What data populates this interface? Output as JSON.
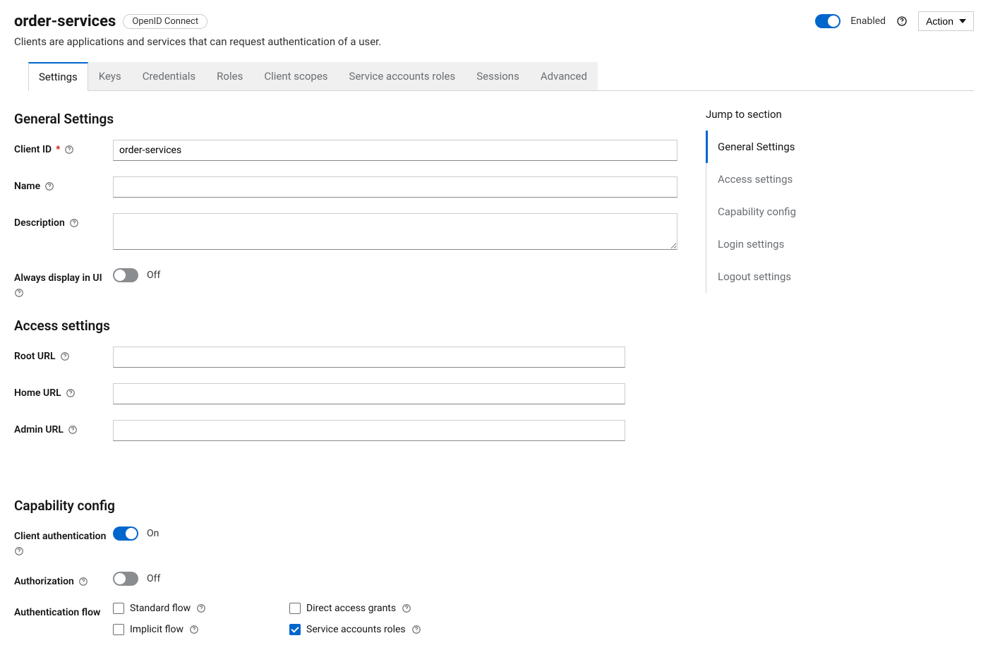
{
  "header": {
    "title": "order-services",
    "badge": "OpenID Connect",
    "subtitle": "Clients are applications and services that can request authentication of a user.",
    "enabled_label": "Enabled",
    "action_label": "Action"
  },
  "tabs": [
    {
      "label": "Settings",
      "active": true
    },
    {
      "label": "Keys"
    },
    {
      "label": "Credentials"
    },
    {
      "label": "Roles"
    },
    {
      "label": "Client scopes"
    },
    {
      "label": "Service accounts roles"
    },
    {
      "label": "Sessions"
    },
    {
      "label": "Advanced"
    }
  ],
  "sections": {
    "general": {
      "title": "General Settings",
      "client_id": {
        "label": "Client ID",
        "value": "order-services"
      },
      "name": {
        "label": "Name",
        "value": ""
      },
      "description": {
        "label": "Description",
        "value": ""
      },
      "always_display": {
        "label": "Always display in UI",
        "state": "Off"
      }
    },
    "access": {
      "title": "Access settings",
      "root_url": {
        "label": "Root URL",
        "value": ""
      },
      "home_url": {
        "label": "Home URL",
        "value": ""
      },
      "admin_url": {
        "label": "Admin URL",
        "value": ""
      }
    },
    "capability": {
      "title": "Capability config",
      "client_auth": {
        "label": "Client authentication",
        "state": "On"
      },
      "authorization": {
        "label": "Authorization",
        "state": "Off"
      },
      "auth_flow_label": "Authentication flow",
      "flows": {
        "standard": {
          "label": "Standard flow",
          "checked": false
        },
        "direct": {
          "label": "Direct access grants",
          "checked": false
        },
        "implicit": {
          "label": "Implicit flow",
          "checked": false
        },
        "service": {
          "label": "Service accounts roles",
          "checked": true
        }
      }
    }
  },
  "jump": {
    "title": "Jump to section",
    "items": [
      {
        "label": "General Settings",
        "active": true
      },
      {
        "label": "Access settings"
      },
      {
        "label": "Capability config"
      },
      {
        "label": "Login settings"
      },
      {
        "label": "Logout settings"
      }
    ]
  }
}
